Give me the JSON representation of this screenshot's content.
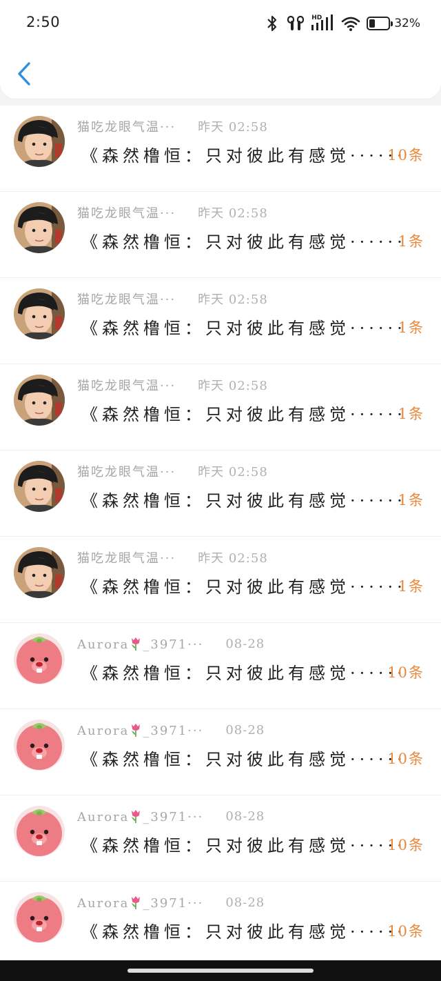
{
  "status_bar": {
    "time": "2:50",
    "signal_label": "HD",
    "battery_percent": "32%",
    "battery_level": 0.32
  },
  "header": {
    "back_icon": "chevron-left-icon",
    "accent_color": "#2e8fdf"
  },
  "colors": {
    "username": "#a6a6a6",
    "title": "#222222",
    "count": "#e9883a"
  },
  "list": [
    {
      "avatar": "boy-portrait",
      "username": "猫吃龙眼气温···",
      "time": "昨天  02:58",
      "title": "《森然橹恒：只对彼此有感觉······",
      "count": "10条"
    },
    {
      "avatar": "boy-portrait",
      "username": "猫吃龙眼气温···",
      "time": "昨天  02:58",
      "title": "《森然橹恒：只对彼此有感觉······",
      "count": "1条"
    },
    {
      "avatar": "boy-portrait",
      "username": "猫吃龙眼气温···",
      "time": "昨天  02:58",
      "title": "《森然橹恒：只对彼此有感觉······",
      "count": "1条"
    },
    {
      "avatar": "boy-portrait",
      "username": "猫吃龙眼气温···",
      "time": "昨天  02:58",
      "title": "《森然橹恒：只对彼此有感觉······",
      "count": "1条"
    },
    {
      "avatar": "boy-portrait",
      "username": "猫吃龙眼气温···",
      "time": "昨天  02:58",
      "title": "《森然橹恒：只对彼此有感觉······",
      "count": "1条"
    },
    {
      "avatar": "boy-portrait",
      "username": "猫吃龙眼气温···",
      "time": "昨天  02:58",
      "title": "《森然橹恒：只对彼此有感觉······",
      "count": "1条"
    },
    {
      "avatar": "pink-beaver",
      "username_prefix": "Aurora",
      "username_suffix": "_3971···",
      "time": "08-28",
      "title": "《森然橹恒：只对彼此有感觉······",
      "count": "10条"
    },
    {
      "avatar": "pink-beaver",
      "username_prefix": "Aurora",
      "username_suffix": "_3971···",
      "time": "08-28",
      "title": "《森然橹恒：只对彼此有感觉······",
      "count": "10条"
    },
    {
      "avatar": "pink-beaver",
      "username_prefix": "Aurora",
      "username_suffix": "_3971···",
      "time": "08-28",
      "title": "《森然橹恒：只对彼此有感觉······",
      "count": "10条"
    },
    {
      "avatar": "pink-beaver",
      "username_prefix": "Aurora",
      "username_suffix": "_3971···",
      "time": "08-28",
      "title": "《森然橹恒：只对彼此有感觉······",
      "count": "10条"
    }
  ]
}
